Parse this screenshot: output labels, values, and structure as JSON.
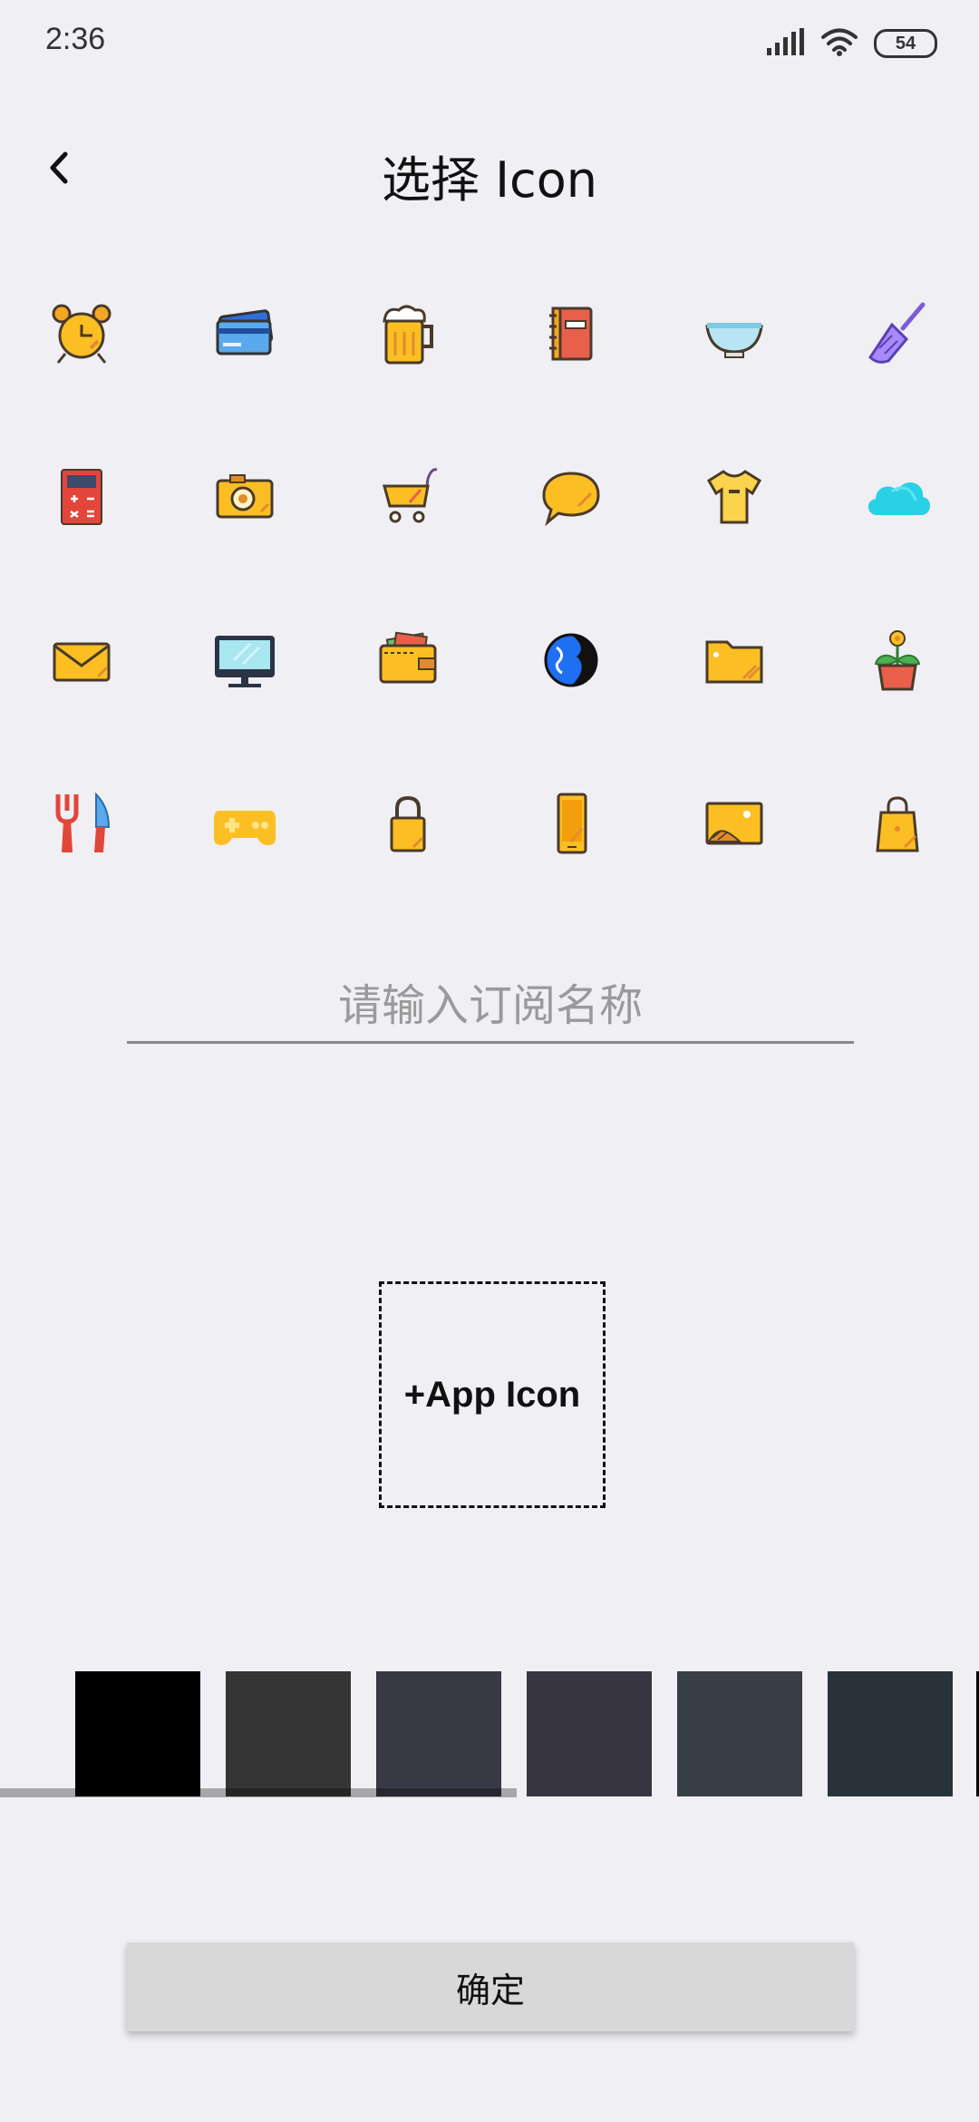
{
  "status_bar": {
    "time": "2:36",
    "battery": "54"
  },
  "header": {
    "title": "选择 Icon",
    "back_icon": "back-arrow-icon"
  },
  "icons": [
    [
      "alarm-clock-icon",
      "credit-card-icon",
      "beer-mug-icon",
      "notebook-icon",
      "bowl-icon",
      "paintbrush-icon"
    ],
    [
      "calculator-icon",
      "camera-icon",
      "shopping-cart-icon",
      "chat-bubble-icon",
      "t-shirt-icon",
      "cloud-icon"
    ],
    [
      "envelope-icon",
      "monitor-icon",
      "wallet-icon",
      "globe-icon",
      "folder-icon",
      "flower-pot-icon"
    ],
    [
      "fork-knife-icon",
      "gamepad-icon",
      "lock-icon",
      "phone-icon",
      "picture-icon",
      "shopping-bag-icon"
    ]
  ],
  "form": {
    "name_placeholder": "请输入订阅名称",
    "name_value": ""
  },
  "app_icon": {
    "label": "+App Icon"
  },
  "colors": [
    "#000000",
    "#353535",
    "#383944",
    "#373542",
    "#384043",
    "#273339"
  ],
  "confirm": {
    "label": "确定"
  }
}
